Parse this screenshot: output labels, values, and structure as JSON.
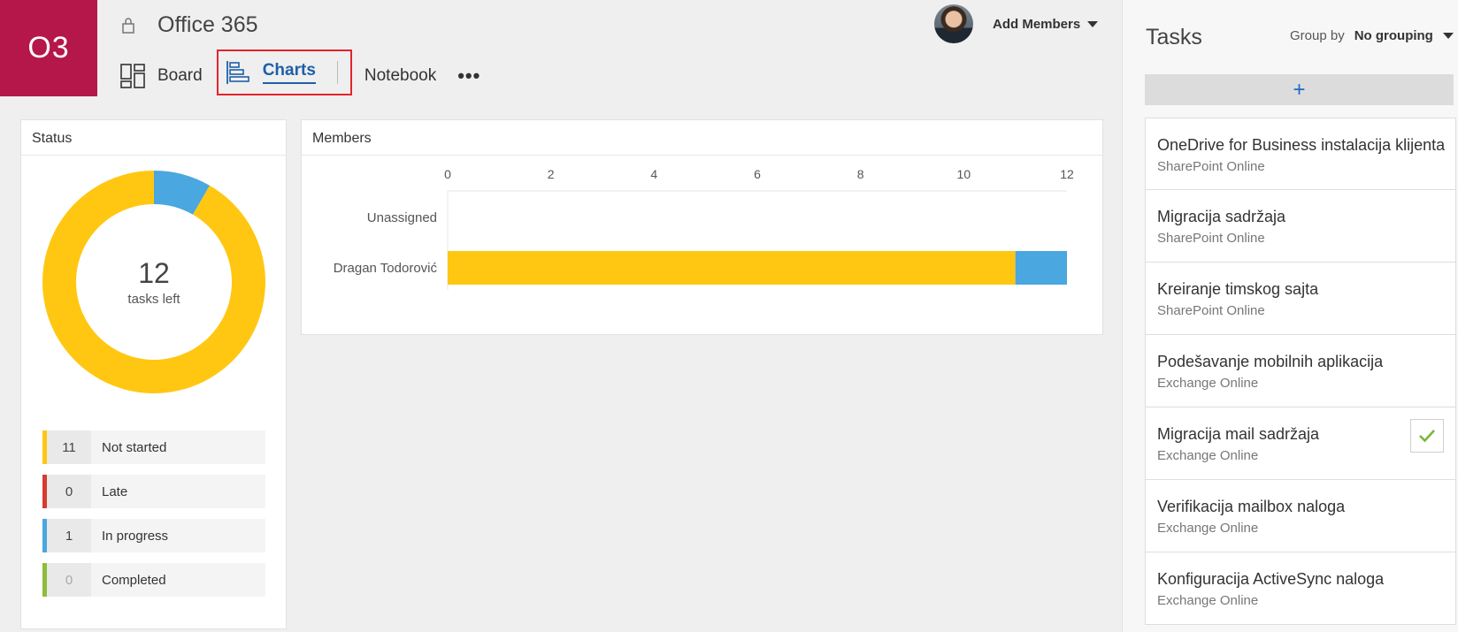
{
  "header": {
    "plan_initials": "O3",
    "plan_title": "Office 365",
    "tabs": [
      {
        "label": "Board"
      },
      {
        "label": "Charts"
      },
      {
        "label": "Notebook"
      }
    ],
    "more_label": "•••",
    "add_members_label": "Add Members"
  },
  "status": {
    "title": "Status",
    "tasks_left_count": "12",
    "tasks_left_label": "tasks left",
    "legend": [
      {
        "count": "11",
        "label": "Not started",
        "color": "#ffc711"
      },
      {
        "count": "0",
        "label": "Late",
        "color": "#d63c31"
      },
      {
        "count": "1",
        "label": "In progress",
        "color": "#4aa7df"
      },
      {
        "count": "0",
        "label": "Completed",
        "color": "#8cbd3b"
      }
    ]
  },
  "chart_data": [
    {
      "type": "pie",
      "title": "Status",
      "slices": [
        {
          "label": "Not started",
          "value": 11,
          "color": "#ffc711"
        },
        {
          "label": "Late",
          "value": 0,
          "color": "#d63c31"
        },
        {
          "label": "In progress",
          "value": 1,
          "color": "#4aa7df"
        },
        {
          "label": "Completed",
          "value": 0,
          "color": "#8cbd3b"
        }
      ]
    },
    {
      "type": "bar",
      "orientation": "horizontal",
      "stacked": true,
      "title": "Members",
      "categories": [
        "Unassigned",
        "Dragan Todorović"
      ],
      "x_ticks": [
        "0",
        "2",
        "4",
        "6",
        "8",
        "10",
        "12"
      ],
      "xlim": [
        0,
        12
      ],
      "series": [
        {
          "name": "Not started",
          "values": [
            0,
            11
          ],
          "color": "#ffc711"
        },
        {
          "name": "In progress",
          "values": [
            0,
            1
          ],
          "color": "#4aa7df"
        }
      ]
    }
  ],
  "tasks": {
    "title": "Tasks",
    "group_by_label": "Group by",
    "group_by_value": "No grouping",
    "add_label": "+",
    "items": [
      {
        "title": "OneDrive for Business instalacija klijenta",
        "bucket": "SharePoint Online",
        "completed": false
      },
      {
        "title": "Migracija sadržaja",
        "bucket": "SharePoint Online",
        "completed": false
      },
      {
        "title": "Kreiranje timskog sajta",
        "bucket": "SharePoint Online",
        "completed": false
      },
      {
        "title": "Podešavanje mobilnih aplikacija",
        "bucket": "Exchange Online",
        "completed": false
      },
      {
        "title": "Migracija mail sadržaja",
        "bucket": "Exchange Online",
        "completed": true
      },
      {
        "title": "Verifikacija mailbox naloga",
        "bucket": "Exchange Online",
        "completed": false
      },
      {
        "title": "Konfiguracija ActiveSync naloga",
        "bucket": "Exchange Online",
        "completed": false
      }
    ]
  }
}
